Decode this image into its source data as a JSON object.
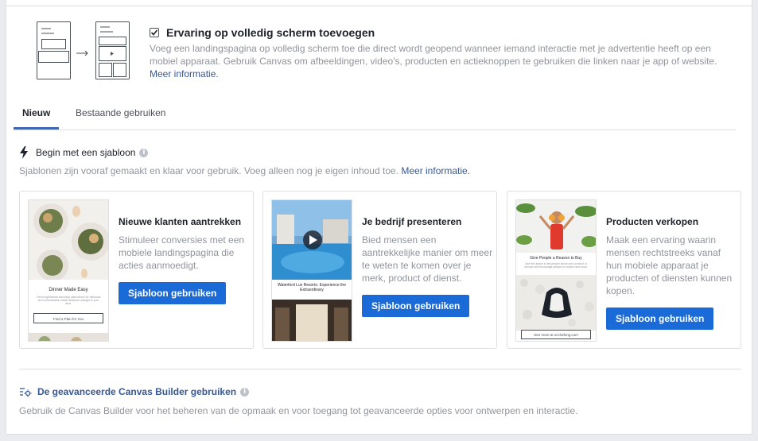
{
  "fullscreen": {
    "title": "Ervaring op volledig scherm toevoegen",
    "description": "Voeg een landingspagina op volledig scherm toe die direct wordt geopend wanneer iemand interactie met je advertentie heeft op een mobiel apparaat. Gebruik Canvas om afbeeldingen, video's, producten en actieknoppen te gebruiken die linken naar je app of website.",
    "link": "Meer informatie."
  },
  "tabs": [
    {
      "label": "Nieuw"
    },
    {
      "label": "Bestaande gebruiken"
    }
  ],
  "template_section": {
    "title": "Begin met een sjabloon",
    "description": "Sjablonen zijn vooraf gemaakt en klaar voor gebruik. Voeg alleen nog je eigen inhoud toe.",
    "link": "Meer informatie."
  },
  "cards": [
    {
      "title": "Nieuwe klanten aantrekken",
      "description": "Stimuleer conversies met een mobiele landingspagina die acties aanmoedigt.",
      "button": "Sjabloon gebruiken",
      "thumb_heading": "Dinner Made Easy",
      "thumb_text": "Fresh ingredients and easy instructions for delicious and customizable meals delivered straight to your door.",
      "thumb_button": "Find a Plan for You"
    },
    {
      "title": "Je bedrijf presenteren",
      "description": "Bied mensen een aantrekkelijke manier om meer te weten te komen over je merk, product of dienst.",
      "button": "Sjabloon gebruiken",
      "thumb_heading": "Waterford Lux Resorts: Experience the Extraordinary"
    },
    {
      "title": "Producten verkopen",
      "description": "Maak een ervaring waarin mensen rechtstreeks vanaf hun mobiele apparaat je producten of diensten kunnen kopen.",
      "button": "Sjabloon gebruiken",
      "thumb_heading": "Give People a Reason to Buy",
      "thumb_text": "Use this space to tell people about your product or service and encourage people to explore and shop.",
      "thumb_button": "See more at occlothing.com"
    }
  ],
  "builder": {
    "title": "De geavanceerde Canvas Builder gebruiken",
    "description": "Gebruik de Canvas Builder voor het beheren van de opmaak en voor toegang tot geavanceerde opties voor ontwerpen en interactie."
  },
  "colors": {
    "accent": "#4267b2",
    "button": "#1a6ad8",
    "link": "#365899"
  }
}
